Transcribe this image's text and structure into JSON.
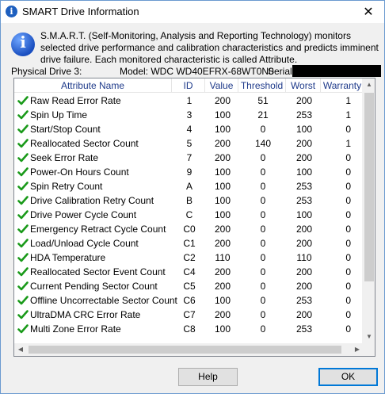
{
  "window": {
    "title": "SMART Drive Information",
    "close_glyph": "✕"
  },
  "description": "S.M.A.R.T. (Self-Monitoring, Analysis and Reporting Technology) monitors selected drive performance and calibration characteristics and predicts imminent drive failure. Each monitored characteristic is called Attribute.",
  "drive": {
    "label": "Physical Drive 3:",
    "model": "Model: WDC WD40EFRX-68WT0N0",
    "serial_label": "Serial:"
  },
  "table": {
    "headers": {
      "name": "Attribute Name",
      "id": "ID",
      "value": "Value",
      "threshold": "Threshold",
      "worst": "Worst",
      "warranty": "Warranty"
    },
    "rows": [
      {
        "name": "Raw Read Error Rate",
        "id": "1",
        "value": "200",
        "threshold": "51",
        "worst": "200",
        "warranty": "1"
      },
      {
        "name": "Spin Up Time",
        "id": "3",
        "value": "100",
        "threshold": "21",
        "worst": "253",
        "warranty": "1"
      },
      {
        "name": "Start/Stop Count",
        "id": "4",
        "value": "100",
        "threshold": "0",
        "worst": "100",
        "warranty": "0"
      },
      {
        "name": "Reallocated Sector Count",
        "id": "5",
        "value": "200",
        "threshold": "140",
        "worst": "200",
        "warranty": "1"
      },
      {
        "name": "Seek Error Rate",
        "id": "7",
        "value": "200",
        "threshold": "0",
        "worst": "200",
        "warranty": "0"
      },
      {
        "name": "Power-On Hours Count",
        "id": "9",
        "value": "100",
        "threshold": "0",
        "worst": "100",
        "warranty": "0"
      },
      {
        "name": "Spin Retry Count",
        "id": "A",
        "value": "100",
        "threshold": "0",
        "worst": "253",
        "warranty": "0"
      },
      {
        "name": "Drive Calibration Retry Count",
        "id": "B",
        "value": "100",
        "threshold": "0",
        "worst": "253",
        "warranty": "0"
      },
      {
        "name": "Drive Power Cycle Count",
        "id": "C",
        "value": "100",
        "threshold": "0",
        "worst": "100",
        "warranty": "0"
      },
      {
        "name": "Emergency Retract Cycle Count",
        "id": "C0",
        "value": "200",
        "threshold": "0",
        "worst": "200",
        "warranty": "0"
      },
      {
        "name": "Load/Unload Cycle Count",
        "id": "C1",
        "value": "200",
        "threshold": "0",
        "worst": "200",
        "warranty": "0"
      },
      {
        "name": "HDA Temperature",
        "id": "C2",
        "value": "110",
        "threshold": "0",
        "worst": "110",
        "warranty": "0"
      },
      {
        "name": "Reallocated Sector Event Count",
        "id": "C4",
        "value": "200",
        "threshold": "0",
        "worst": "200",
        "warranty": "0"
      },
      {
        "name": "Current Pending Sector Count",
        "id": "C5",
        "value": "200",
        "threshold": "0",
        "worst": "200",
        "warranty": "0"
      },
      {
        "name": "Offline Uncorrectable Sector Count",
        "id": "C6",
        "value": "100",
        "threshold": "0",
        "worst": "253",
        "warranty": "0"
      },
      {
        "name": "UltraDMA CRC Error Rate",
        "id": "C7",
        "value": "200",
        "threshold": "0",
        "worst": "200",
        "warranty": "0"
      },
      {
        "name": "Multi Zone Error Rate",
        "id": "C8",
        "value": "100",
        "threshold": "0",
        "worst": "253",
        "warranty": "0"
      }
    ]
  },
  "buttons": {
    "help": "Help",
    "ok": "OK"
  },
  "colors": {
    "header_text": "#1e3a8a",
    "check": "#1a9a1a",
    "accent": "#0078d7"
  },
  "icons": {
    "title": "info-icon",
    "row_status": "green-check-icon"
  }
}
